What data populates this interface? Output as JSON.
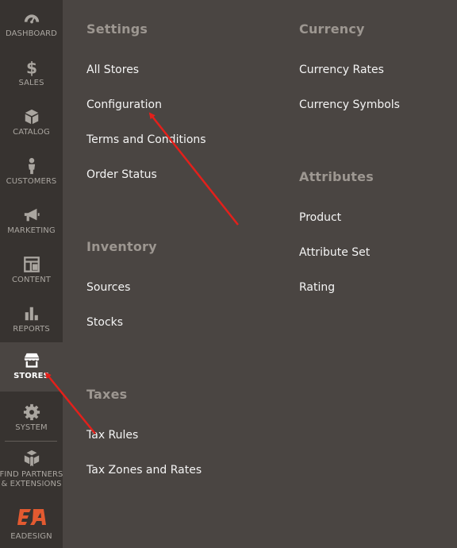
{
  "sidebar": {
    "items": [
      {
        "name": "dashboard",
        "label": "DASHBOARD",
        "icon": "speedometer-icon"
      },
      {
        "name": "sales",
        "label": "SALES",
        "icon": "dollar-icon"
      },
      {
        "name": "catalog",
        "label": "CATALOG",
        "icon": "box-icon"
      },
      {
        "name": "customers",
        "label": "CUSTOMERS",
        "icon": "person-icon"
      },
      {
        "name": "marketing",
        "label": "MARKETING",
        "icon": "megaphone-icon"
      },
      {
        "name": "content",
        "label": "CONTENT",
        "icon": "layout-icon"
      },
      {
        "name": "reports",
        "label": "REPORTS",
        "icon": "bar-chart-icon"
      },
      {
        "name": "stores",
        "label": "STORES",
        "icon": "storefront-icon",
        "active": true
      },
      {
        "name": "system",
        "label": "SYSTEM",
        "icon": "gear-icon"
      },
      {
        "name": "partners",
        "label": "FIND PARTNERS",
        "label2": "& EXTENSIONS",
        "icon": "blocks-icon"
      }
    ],
    "logo": {
      "label": "EADESIGN",
      "text": "EA",
      "color": "#e35a30"
    }
  },
  "panel": {
    "settings": {
      "title": "Settings",
      "links": [
        "All Stores",
        "Configuration",
        "Terms and Conditions",
        "Order Status"
      ]
    },
    "inventory": {
      "title": "Inventory",
      "links": [
        "Sources",
        "Stocks"
      ]
    },
    "taxes": {
      "title": "Taxes",
      "links": [
        "Tax Rules",
        "Tax Zones and Rates"
      ]
    },
    "currency": {
      "title": "Currency",
      "links": [
        "Currency Rates",
        "Currency Symbols"
      ]
    },
    "attributes": {
      "title": "Attributes",
      "links": [
        "Product",
        "Attribute Set",
        "Rating"
      ]
    }
  },
  "colors": {
    "sidebar_bg": "#373330",
    "panel_bg": "#4a4542",
    "annotation_arrow": "#e3201b"
  }
}
